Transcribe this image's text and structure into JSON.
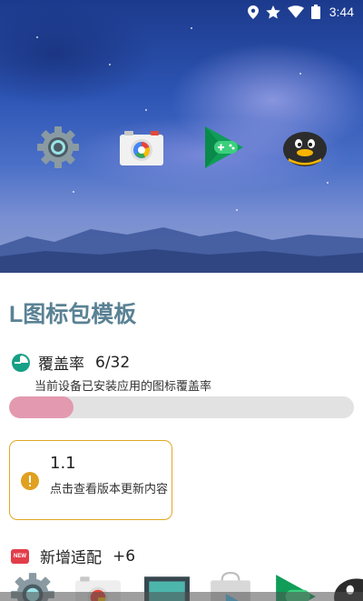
{
  "status_bar": {
    "icons": [
      "location-icon",
      "star-icon",
      "wifi-icon",
      "battery-icon"
    ],
    "time": "3:44"
  },
  "hero": {
    "icons": [
      "settings-app-icon",
      "camera-app-icon",
      "play-games-app-icon",
      "qq-app-icon"
    ]
  },
  "app": {
    "title": "L图标包模板"
  },
  "coverage": {
    "icon": "pie-chart-icon",
    "label": "覆盖率",
    "count": "6/32",
    "description": "当前设备已安装应用的图标覆盖率",
    "progress_fraction": 0.1875,
    "progress_color": "#e39ab0"
  },
  "version_card": {
    "icon": "info-icon",
    "version": "1.1",
    "description": "点击查看版本更新内容",
    "accent_color": "#e0a826"
  },
  "new_adapted": {
    "badge": "NEW",
    "label": "新增适配",
    "count": "+6",
    "icons": [
      "settings-app-icon",
      "camera-app-icon",
      "gallery-app-icon",
      "store-app-icon",
      "play-games-app-icon",
      "qq-app-icon"
    ]
  },
  "colors": {
    "title": "#5a8294",
    "progress_track": "#e2e2e2"
  }
}
